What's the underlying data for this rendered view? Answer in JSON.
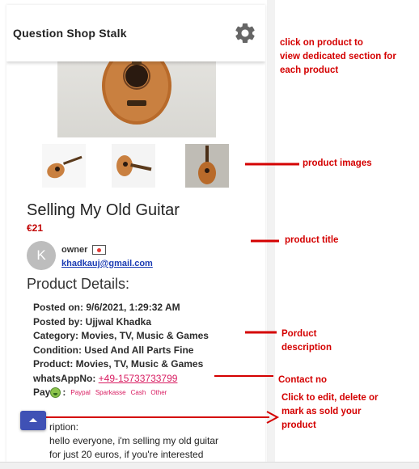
{
  "app": {
    "title": "Question Shop Stalk",
    "settings_icon": "gear-icon"
  },
  "product": {
    "title": "Selling My Old Guitar",
    "price": "€21",
    "owner": {
      "avatar_letter": "K",
      "label": "owner",
      "email": "khadkauj@gmail.com",
      "flag_icon": "flag-icon"
    },
    "details_heading": "Product Details:",
    "details": {
      "posted_on": "Posted on: 9/6/2021, 1:29:32 AM",
      "posted_by": "Posted by: Ujjwal Khadka",
      "category": "Category: Movies, TV, Music & Games",
      "condition": "Condition: Used And All Parts Fine",
      "product": "Product: Movies, TV, Music & Games",
      "whatsapp_label": "whatsAppNo:",
      "whatsapp_number": "+49-15733733799",
      "pay_label": "Pay",
      "pay_suffix": ":",
      "pay_options": [
        "Paypal",
        "Sparkasse",
        "Cash",
        "Other"
      ]
    },
    "description": {
      "label_partial": "ription:",
      "line1": "hello everyone, i'm selling my old guitar",
      "line2": "for just 20 euros, if you're interested"
    }
  },
  "annotations": {
    "click_product": [
      "click on product to",
      "view dedicated section for",
      "each product"
    ],
    "product_images": "product images",
    "product_title": "product title",
    "description": [
      "Porduct",
      "description"
    ],
    "contact": "Contact no",
    "edit": [
      "Click to edit, delete or",
      "mark as sold your",
      "product"
    ]
  },
  "colors": {
    "accent": "#3f51b5",
    "price": "#c00000",
    "annotation": "#d40000",
    "link_pink": "#d81b60"
  }
}
